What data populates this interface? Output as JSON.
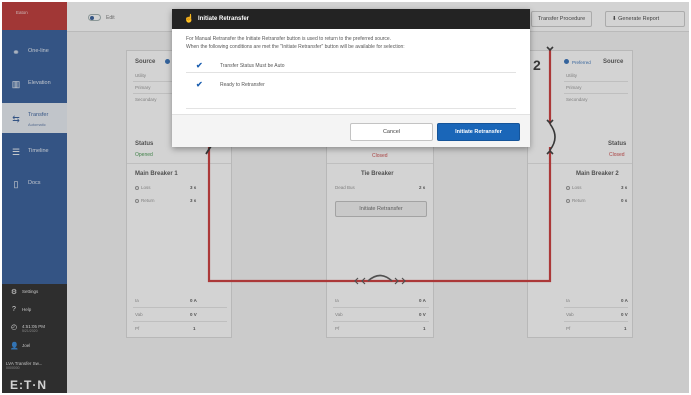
{
  "sidebar": {
    "brand": "Eaton",
    "items": [
      {
        "label": "One-line",
        "sub": "",
        "icon": "one-line-icon"
      },
      {
        "label": "Elevation",
        "sub": "",
        "icon": "elevation-icon"
      },
      {
        "label": "Transfer",
        "sub": "Automatic",
        "icon": "transfer-icon"
      },
      {
        "label": "Timeline",
        "sub": "",
        "icon": "timeline-icon"
      },
      {
        "label": "Docs",
        "sub": "",
        "icon": "docs-icon"
      }
    ],
    "bottom": [
      {
        "label": "Settings",
        "sub": "",
        "icon": "gear-icon"
      },
      {
        "label": "Help",
        "sub": "",
        "icon": "help-icon"
      },
      {
        "label": "4:51:05 PM",
        "sub": "5/21/2020",
        "icon": "clock-icon"
      },
      {
        "label": "Joel",
        "sub": "",
        "icon": "user-icon"
      },
      {
        "label": "LVA Transfer Sw...",
        "sub": "0000000",
        "icon": "device-icon"
      }
    ],
    "logo": "E:T·N"
  },
  "topbar": {
    "edit_label": "Edit",
    "transfer_procedure": "Transfer Procedure",
    "generate_report": "Generate Report"
  },
  "panels": {
    "left": {
      "title": "Source",
      "rows": [
        "Utility",
        "Primary",
        "Secondary"
      ],
      "status_label": "Status",
      "status_value": "Opened",
      "breaker": "Main Breaker 1",
      "breaker_rows": [
        {
          "label": "Loss",
          "value": "3 s"
        },
        {
          "label": "Return",
          "value": "3 s"
        }
      ],
      "meters": [
        {
          "label": "Ia",
          "value": "0 A"
        },
        {
          "label": "Vab",
          "value": "0 V"
        },
        {
          "label": "Pf",
          "value": "1"
        }
      ]
    },
    "center": {
      "status_value": "Closed",
      "breaker": "Tie Breaker",
      "breaker_rows": [
        {
          "label": "Dead Bus",
          "value": "2 s"
        }
      ],
      "button": "Initiate Retransfer",
      "meters": [
        {
          "label": "Ia",
          "value": "0 A"
        },
        {
          "label": "Vab",
          "value": "0 V"
        },
        {
          "label": "Pf",
          "value": "1"
        }
      ]
    },
    "right": {
      "number": "2",
      "title": "Source",
      "preferred": "Preferred",
      "rows": [
        "Utility",
        "Primary",
        "Secondary"
      ],
      "status_label": "Status",
      "status_value": "Closed",
      "breaker": "Main Breaker 2",
      "breaker_rows": [
        {
          "label": "Loss",
          "value": "3 s"
        },
        {
          "label": "Return",
          "value": "0 s"
        }
      ],
      "meters": [
        {
          "label": "Ia",
          "value": "0 A"
        },
        {
          "label": "Vab",
          "value": "0 V"
        },
        {
          "label": "Pf",
          "value": "1"
        }
      ]
    }
  },
  "modal": {
    "title": "Initiate Retransfer",
    "line1": "For Manual Retransfer the Initiate Retransfer button is used to return to the preferred source.",
    "line2": "When the following conditions are met the \"Initiate Retransfer\" button will be available for selection:",
    "conditions": [
      "Transfer Status Must be Auto",
      "Ready to Retransfer"
    ],
    "cancel": "Cancel",
    "confirm": "Initiate Retransfer"
  },
  "colors": {
    "accent": "#1a66b8",
    "sidebar": "#1c4a8e",
    "brand": "#b8201f",
    "line": "#c62222"
  }
}
